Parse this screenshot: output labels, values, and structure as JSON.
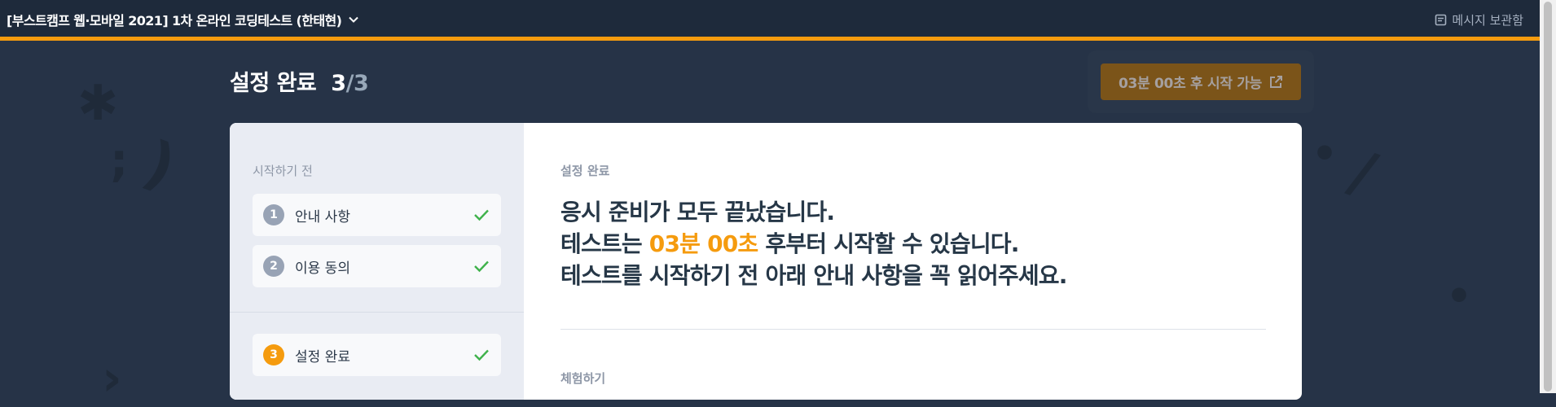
{
  "topbar": {
    "title": "[부스트캠프 웹·모바일 2021] 1차 온라인 코딩테스트  (한태현)",
    "dropdown_icon": "chevron-down-icon",
    "message_box_label": "메시지 보관함",
    "message_icon": "message-box-icon",
    "accent_color": "#f59b0e"
  },
  "page": {
    "title": "설정 완료",
    "current_step": "3",
    "separator": "/",
    "total_steps": "3"
  },
  "start_button": {
    "label": "03분 00초 후 시작 가능",
    "icon": "external-link-icon",
    "enabled": false
  },
  "sidebar": {
    "section_label": "시작하기 전",
    "steps": [
      {
        "number": "1",
        "label": "안내 사항",
        "done": true
      },
      {
        "number": "2",
        "label": "이용 동의",
        "done": true
      },
      {
        "number": "3",
        "label": "설정 완료",
        "done": true,
        "active": true
      }
    ]
  },
  "main": {
    "kicker": "설정 완료",
    "line1": "응시 준비가 모두 끝났습니다.",
    "line2_prefix": "테스트는 ",
    "line2_time": "03분 00초",
    "line2_suffix": " 후부터 시작할 수 있습니다.",
    "line3": "테스트를 시작하기 전 아래 안내 사항을 꼭 읽어주세요.",
    "section_try": "체험하기"
  }
}
